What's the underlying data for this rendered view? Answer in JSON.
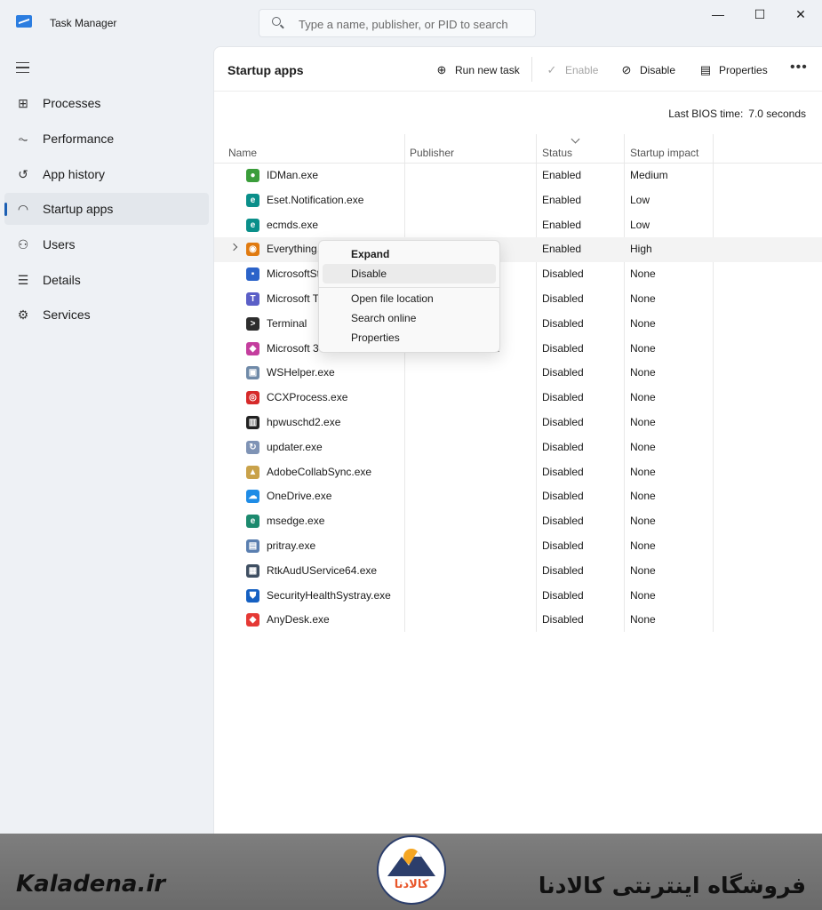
{
  "window": {
    "title": "Task Manager",
    "controls": {
      "minimize": "—",
      "maximize": "☐",
      "close": "✕"
    }
  },
  "search": {
    "placeholder": "Type a name, publisher, or PID to search"
  },
  "sidebar": {
    "items": [
      {
        "label": "Processes",
        "icon": "processes-icon"
      },
      {
        "label": "Performance",
        "icon": "performance-icon"
      },
      {
        "label": "App history",
        "icon": "app-history-icon"
      },
      {
        "label": "Startup apps",
        "icon": "startup-apps-icon",
        "active": true
      },
      {
        "label": "Users",
        "icon": "users-icon"
      },
      {
        "label": "Details",
        "icon": "details-icon"
      },
      {
        "label": "Services",
        "icon": "services-icon"
      }
    ]
  },
  "toolbar": {
    "page_title": "Startup apps",
    "run_new_task": "Run new task",
    "enable": "Enable",
    "disable": "Disable",
    "properties": "Properties",
    "more": "•••"
  },
  "bios": {
    "label": "Last BIOS time:",
    "value": "7.0 seconds"
  },
  "table": {
    "columns": [
      "Name",
      "Publisher",
      "Status",
      "Startup impact"
    ],
    "rows": [
      {
        "name": "IDMan.exe",
        "publisher": "",
        "status": "Enabled",
        "impact": "Medium",
        "icon_color": "#3a9d3a",
        "icon_glyph": "●"
      },
      {
        "name": "Eset.Notification.exe",
        "publisher": "",
        "status": "Enabled",
        "impact": "Low",
        "icon_color": "#0a8f8a",
        "icon_glyph": "e"
      },
      {
        "name": "ecmds.exe",
        "publisher": "",
        "status": "Enabled",
        "impact": "Low",
        "icon_color": "#0a8f8a",
        "icon_glyph": "e"
      },
      {
        "name": "Everything.",
        "publisher": "",
        "status": "Enabled",
        "impact": "High",
        "icon_color": "#e07a10",
        "icon_glyph": "◉"
      },
      {
        "name": "MicrosoftSt",
        "publisher": "on",
        "status": "Disabled",
        "impact": "None",
        "icon_color": "#2b63c9",
        "icon_glyph": "▪"
      },
      {
        "name": "Microsoft T",
        "publisher": "",
        "status": "Disabled",
        "impact": "None",
        "icon_color": "#5b5fc7",
        "icon_glyph": "T"
      },
      {
        "name": "Terminal",
        "publisher": "on",
        "status": "Disabled",
        "impact": "None",
        "icon_color": "#2d2d2d",
        "icon_glyph": ">"
      },
      {
        "name": "Microsoft 3",
        "publisher": "on",
        "status": "Disabled",
        "impact": "None",
        "icon_color": "#c43e9e",
        "icon_glyph": "◆"
      },
      {
        "name": "WSHelper.exe",
        "publisher": "",
        "status": "Disabled",
        "impact": "None",
        "icon_color": "#6f8aa8",
        "icon_glyph": "▣"
      },
      {
        "name": "CCXProcess.exe",
        "publisher": "",
        "status": "Disabled",
        "impact": "None",
        "icon_color": "#d62a2a",
        "icon_glyph": "◎"
      },
      {
        "name": "hpwuschd2.exe",
        "publisher": "",
        "status": "Disabled",
        "impact": "None",
        "icon_color": "#222222",
        "icon_glyph": "▥"
      },
      {
        "name": "updater.exe",
        "publisher": "",
        "status": "Disabled",
        "impact": "None",
        "icon_color": "#7f93b5",
        "icon_glyph": "↻"
      },
      {
        "name": "AdobeCollabSync.exe",
        "publisher": "",
        "status": "Disabled",
        "impact": "None",
        "icon_color": "#c9a24a",
        "icon_glyph": "▲"
      },
      {
        "name": "OneDrive.exe",
        "publisher": "",
        "status": "Disabled",
        "impact": "None",
        "icon_color": "#1f8ce6",
        "icon_glyph": "☁"
      },
      {
        "name": "msedge.exe",
        "publisher": "",
        "status": "Disabled",
        "impact": "None",
        "icon_color": "#1c8a6e",
        "icon_glyph": "e"
      },
      {
        "name": "pritray.exe",
        "publisher": "",
        "status": "Disabled",
        "impact": "None",
        "icon_color": "#5a7fb0",
        "icon_glyph": "▤"
      },
      {
        "name": "RtkAudUService64.exe",
        "publisher": "",
        "status": "Disabled",
        "impact": "None",
        "icon_color": "#3f4f62",
        "icon_glyph": "▦"
      },
      {
        "name": "SecurityHealthSystray.exe",
        "publisher": "",
        "status": "Disabled",
        "impact": "None",
        "icon_color": "#1560c2",
        "icon_glyph": "⛊"
      },
      {
        "name": "AnyDesk.exe",
        "publisher": "",
        "status": "Disabled",
        "impact": "None",
        "icon_color": "#e53935",
        "icon_glyph": "◆"
      }
    ]
  },
  "context_menu": {
    "items": [
      "Expand",
      "Disable",
      "Open file location",
      "Search online",
      "Properties"
    ]
  },
  "banner": {
    "left_brand": "Kaladena.ir",
    "right_brand": "فروشگاه اینترنتی کالادنا",
    "logo_text": "کالادنا"
  }
}
